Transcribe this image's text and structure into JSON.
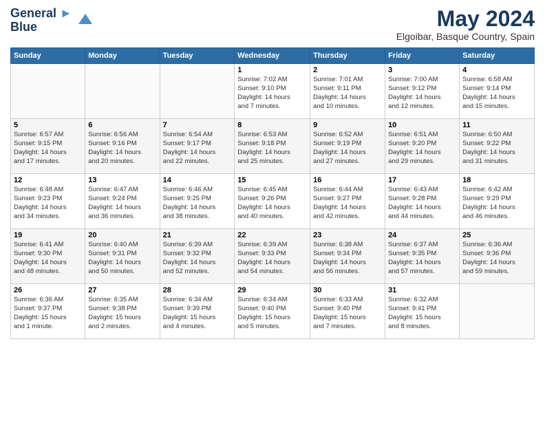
{
  "logo": {
    "line1": "General",
    "line2": "Blue"
  },
  "title": "May 2024",
  "location": "Elgoibar, Basque Country, Spain",
  "weekdays": [
    "Sunday",
    "Monday",
    "Tuesday",
    "Wednesday",
    "Thursday",
    "Friday",
    "Saturday"
  ],
  "weeks": [
    [
      {
        "day": "",
        "info": ""
      },
      {
        "day": "",
        "info": ""
      },
      {
        "day": "",
        "info": ""
      },
      {
        "day": "1",
        "info": "Sunrise: 7:02 AM\nSunset: 9:10 PM\nDaylight: 14 hours\nand 7 minutes."
      },
      {
        "day": "2",
        "info": "Sunrise: 7:01 AM\nSunset: 9:11 PM\nDaylight: 14 hours\nand 10 minutes."
      },
      {
        "day": "3",
        "info": "Sunrise: 7:00 AM\nSunset: 9:12 PM\nDaylight: 14 hours\nand 12 minutes."
      },
      {
        "day": "4",
        "info": "Sunrise: 6:58 AM\nSunset: 9:14 PM\nDaylight: 14 hours\nand 15 minutes."
      }
    ],
    [
      {
        "day": "5",
        "info": "Sunrise: 6:57 AM\nSunset: 9:15 PM\nDaylight: 14 hours\nand 17 minutes."
      },
      {
        "day": "6",
        "info": "Sunrise: 6:56 AM\nSunset: 9:16 PM\nDaylight: 14 hours\nand 20 minutes."
      },
      {
        "day": "7",
        "info": "Sunrise: 6:54 AM\nSunset: 9:17 PM\nDaylight: 14 hours\nand 22 minutes."
      },
      {
        "day": "8",
        "info": "Sunrise: 6:53 AM\nSunset: 9:18 PM\nDaylight: 14 hours\nand 25 minutes."
      },
      {
        "day": "9",
        "info": "Sunrise: 6:52 AM\nSunset: 9:19 PM\nDaylight: 14 hours\nand 27 minutes."
      },
      {
        "day": "10",
        "info": "Sunrise: 6:51 AM\nSunset: 9:20 PM\nDaylight: 14 hours\nand 29 minutes."
      },
      {
        "day": "11",
        "info": "Sunrise: 6:50 AM\nSunset: 9:22 PM\nDaylight: 14 hours\nand 31 minutes."
      }
    ],
    [
      {
        "day": "12",
        "info": "Sunrise: 6:48 AM\nSunset: 9:23 PM\nDaylight: 14 hours\nand 34 minutes."
      },
      {
        "day": "13",
        "info": "Sunrise: 6:47 AM\nSunset: 9:24 PM\nDaylight: 14 hours\nand 36 minutes."
      },
      {
        "day": "14",
        "info": "Sunrise: 6:46 AM\nSunset: 9:25 PM\nDaylight: 14 hours\nand 38 minutes."
      },
      {
        "day": "15",
        "info": "Sunrise: 6:45 AM\nSunset: 9:26 PM\nDaylight: 14 hours\nand 40 minutes."
      },
      {
        "day": "16",
        "info": "Sunrise: 6:44 AM\nSunset: 9:27 PM\nDaylight: 14 hours\nand 42 minutes."
      },
      {
        "day": "17",
        "info": "Sunrise: 6:43 AM\nSunset: 9:28 PM\nDaylight: 14 hours\nand 44 minutes."
      },
      {
        "day": "18",
        "info": "Sunrise: 6:42 AM\nSunset: 9:29 PM\nDaylight: 14 hours\nand 46 minutes."
      }
    ],
    [
      {
        "day": "19",
        "info": "Sunrise: 6:41 AM\nSunset: 9:30 PM\nDaylight: 14 hours\nand 48 minutes."
      },
      {
        "day": "20",
        "info": "Sunrise: 6:40 AM\nSunset: 9:31 PM\nDaylight: 14 hours\nand 50 minutes."
      },
      {
        "day": "21",
        "info": "Sunrise: 6:39 AM\nSunset: 9:32 PM\nDaylight: 14 hours\nand 52 minutes."
      },
      {
        "day": "22",
        "info": "Sunrise: 6:39 AM\nSunset: 9:33 PM\nDaylight: 14 hours\nand 54 minutes."
      },
      {
        "day": "23",
        "info": "Sunrise: 6:38 AM\nSunset: 9:34 PM\nDaylight: 14 hours\nand 56 minutes."
      },
      {
        "day": "24",
        "info": "Sunrise: 6:37 AM\nSunset: 9:35 PM\nDaylight: 14 hours\nand 57 minutes."
      },
      {
        "day": "25",
        "info": "Sunrise: 6:36 AM\nSunset: 9:36 PM\nDaylight: 14 hours\nand 59 minutes."
      }
    ],
    [
      {
        "day": "26",
        "info": "Sunrise: 6:36 AM\nSunset: 9:37 PM\nDaylight: 15 hours\nand 1 minute."
      },
      {
        "day": "27",
        "info": "Sunrise: 6:35 AM\nSunset: 9:38 PM\nDaylight: 15 hours\nand 2 minutes."
      },
      {
        "day": "28",
        "info": "Sunrise: 6:34 AM\nSunset: 9:39 PM\nDaylight: 15 hours\nand 4 minutes."
      },
      {
        "day": "29",
        "info": "Sunrise: 6:34 AM\nSunset: 9:40 PM\nDaylight: 15 hours\nand 5 minutes."
      },
      {
        "day": "30",
        "info": "Sunrise: 6:33 AM\nSunset: 9:40 PM\nDaylight: 15 hours\nand 7 minutes."
      },
      {
        "day": "31",
        "info": "Sunrise: 6:32 AM\nSunset: 9:41 PM\nDaylight: 15 hours\nand 8 minutes."
      },
      {
        "day": "",
        "info": ""
      }
    ]
  ]
}
